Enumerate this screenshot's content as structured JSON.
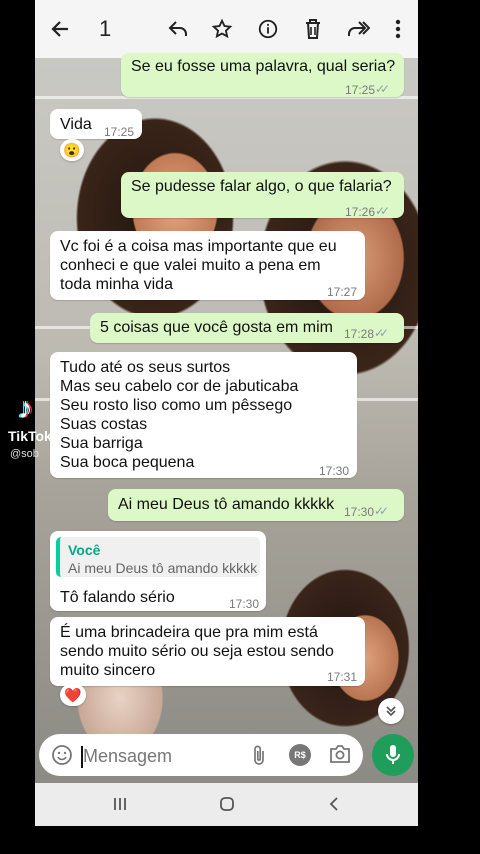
{
  "header": {
    "selected_count": "1",
    "icons": [
      "back-arrow-icon",
      "reply-icon",
      "star-icon",
      "info-icon",
      "delete-icon",
      "forward-icon",
      "more-icon"
    ]
  },
  "messages": [
    {
      "dir": "out",
      "text": "Se eu fosse uma palavra, qual seria?",
      "time": "17:25",
      "read": true
    },
    {
      "dir": "in",
      "text": "Vida",
      "time": "17:25",
      "emoji": "😮"
    },
    {
      "dir": "out",
      "text": "Se pudesse falar algo, o que falaria?",
      "time": "17:26",
      "read": true
    },
    {
      "dir": "in",
      "text": "Vc foi é a coisa mas importante que eu\nconheci e que valei muito a pena em\ntoda minha vida",
      "time": "17:27"
    },
    {
      "dir": "out",
      "text": "5 coisas que você gosta em mim",
      "time": "17:28",
      "read": true
    },
    {
      "dir": "in",
      "text": "Tudo até os seus surtos\nMas seu cabelo cor de jabuticaba\nSeu rosto liso como um pêssego\nSuas costas\nSua barriga\nSua boca pequena",
      "time": "17:30"
    },
    {
      "dir": "out",
      "text": "Ai meu Deus tô amando kkkkk",
      "time": "17:30",
      "read": true
    },
    {
      "dir": "in",
      "quote_name": "Você",
      "quote_text": "Ai meu Deus tô amando kkkkk",
      "text": "Tô falando sério",
      "time": "17:30"
    },
    {
      "dir": "in",
      "text": "É uma brincadeira que pra mim está\nsendo muito sério ou seja estou sendo\nmuito sincero",
      "time": "17:31",
      "reaction": "❤️"
    }
  ],
  "input": {
    "placeholder": "Mensagem",
    "icons": [
      "emoji-icon",
      "attach-icon",
      "payment-icon",
      "camera-icon",
      "mic-icon"
    ],
    "payment_label": "R$"
  },
  "navbar": {
    "icons": [
      "recents-icon",
      "home-icon",
      "back-icon"
    ]
  },
  "watermark": {
    "brand": "TikTok",
    "handle": "@sob"
  },
  "colors": {
    "outgoing": "#dcf8c6",
    "incoming": "#ffffff",
    "accent": "#1e9e5a",
    "read_ticks": "#8fa0a6"
  }
}
